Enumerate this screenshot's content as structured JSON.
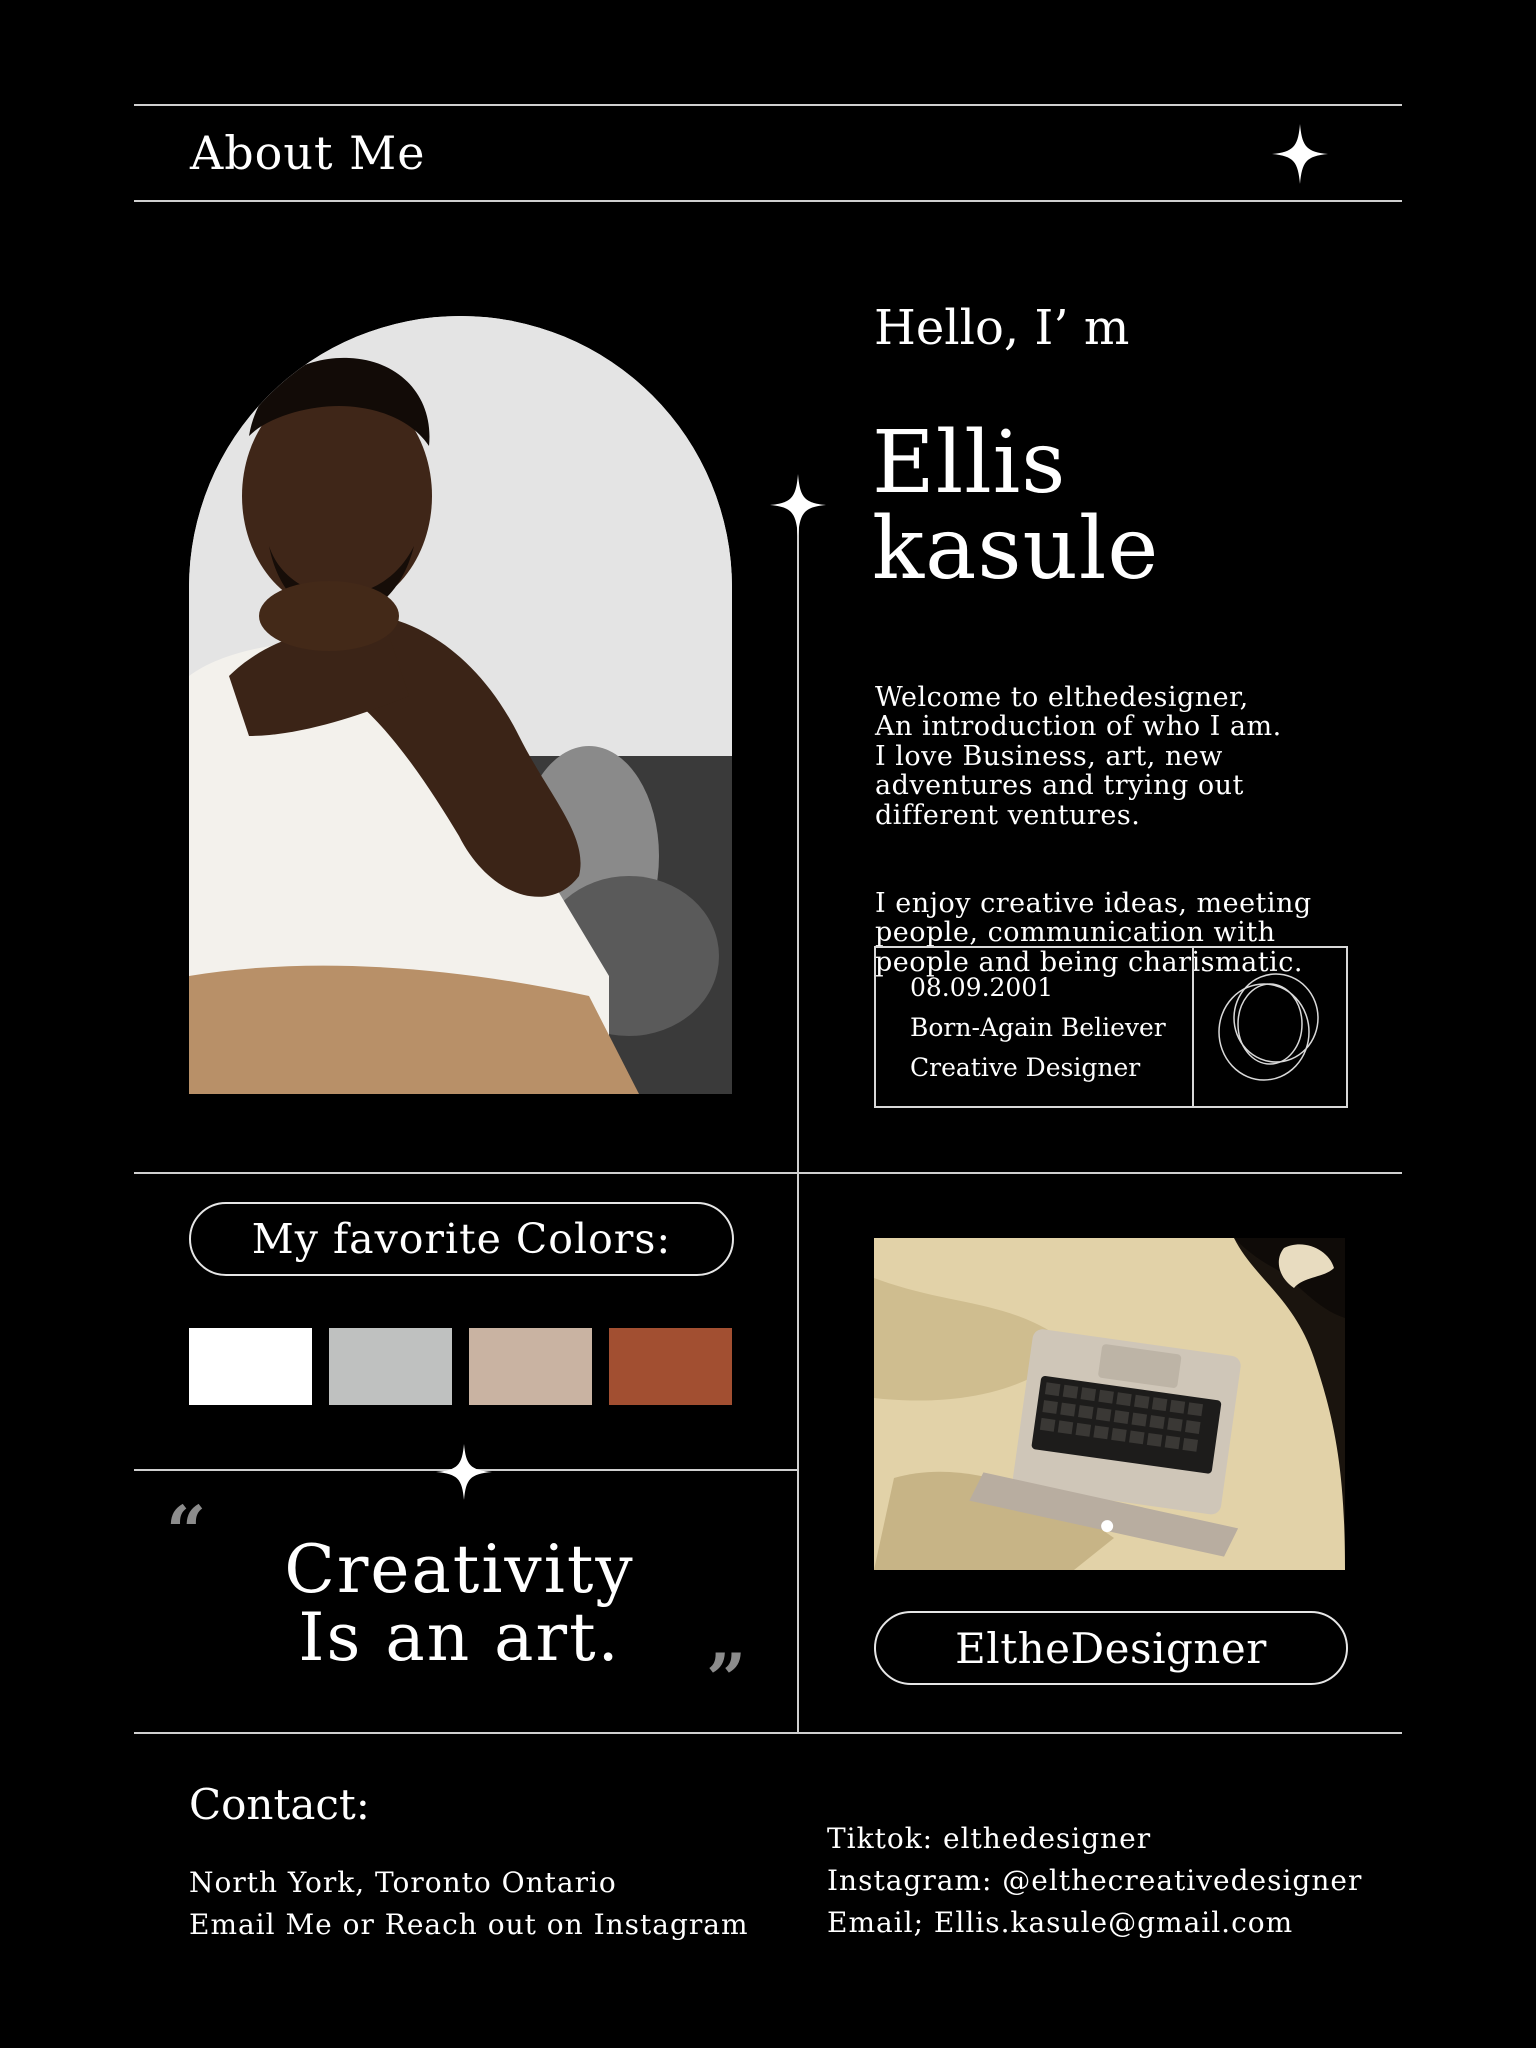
{
  "header": {
    "title": "About Me"
  },
  "intro": {
    "greeting": "Hello, I’ m",
    "first_name": "Ellis",
    "last_name": "kasule",
    "bio_1": "Welcome to elthedesigner,\nAn introduction of who I am.\nI love Business, art, new\nadventures and trying out\ndifferent ventures.",
    "bio_2": "I enjoy creative ideas, meeting\npeople, communication with\npeople and being charismatic."
  },
  "info": {
    "dob": "08.09.2001",
    "faith": "Born-Again Believer",
    "role": "Creative Designer"
  },
  "colors": {
    "heading": "My favorite Colors:",
    "swatches": [
      "#ffffff",
      "#bfc1c0",
      "#c9b3a2",
      "#a24f31"
    ]
  },
  "quote": {
    "open": "“",
    "close": "”",
    "text": "Creativity\nIs an art."
  },
  "handle": "EltheDesigner",
  "contact": {
    "title": "Contact:",
    "location": "North York, Toronto Ontario",
    "note": "Email Me or Reach out on Instagram",
    "tiktok": "Tiktok: elthedesigner",
    "instagram": "Instagram: @elthecreativedesigner",
    "email": "Email; Ellis.kasule@gmail.com"
  },
  "icons": [
    "sparkle-icon",
    "rings-icon",
    "quote-open-icon",
    "quote-close-icon"
  ]
}
